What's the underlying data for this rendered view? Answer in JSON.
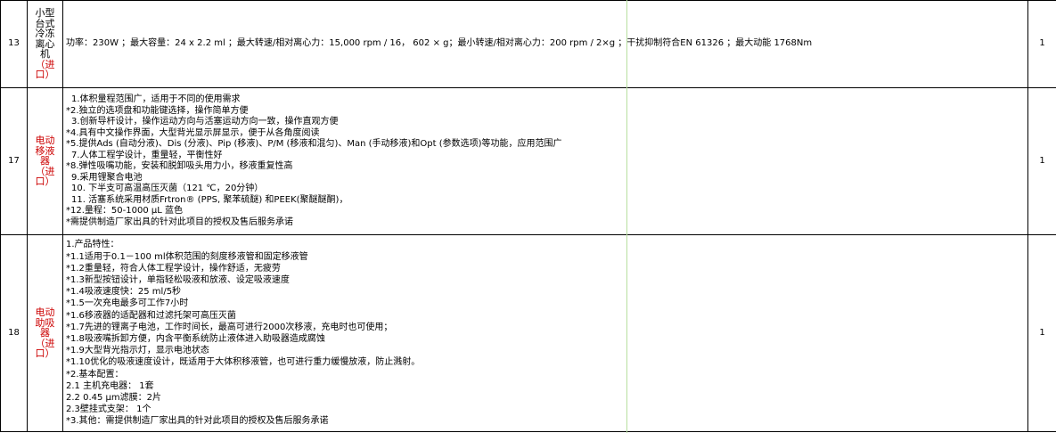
{
  "rows": [
    {
      "index": "13",
      "name_lines": [
        "小型",
        "台式",
        "冷冻",
        "离心",
        "机"
      ],
      "import_lines": [
        "（进",
        "口）"
      ],
      "spec_lines": [
        "功率：230W ；最大容量：24 x 2.2 ml ；最大转速/相对离心力：15,000 rpm / 16， 602 × g；最小转速/相对离心力：200 rpm / 2×g ；干扰抑制符合EN 61326 ；最大动能 1768Nm"
      ],
      "qty": "1"
    },
    {
      "index": "17",
      "name_lines": [
        "电动",
        "移液",
        "器"
      ],
      "import_lines": [
        "（进",
        "口）"
      ],
      "spec_lines": [
        "1.体积量程范围广，适用于不同的使用需求",
        "*2.独立的选项盘和功能键选择，操作简单方便",
        "3.创新导杆设计，操作运动方向与活塞运动方向一致，操作直观方便",
        "*4.具有中文操作界面，大型背光显示屏显示，便于从各角度阅读",
        "*5.提供Ads (自动分液)、Dis (分液)、Pip (移液)、P/M (移液和混匀)、Man (手动移液)和Opt (参数选项)等功能，应用范围广",
        "7.人体工程学设计，重量轻，平衡性好",
        "*8.弹性吸嘴功能，安装和脱卸吸头用力小，移液重复性高",
        "9.采用锂聚合电池",
        "10. 下半支可高温高压灭菌（121 ℃，20分钟）",
        "11. 活塞系统采用材质Frtron® (PPS, 聚苯硫醚) 和PEEK(聚醚醚酮)，",
        "*12.量程：50-1000 μL  蓝色",
        "*需提供制造厂家出具的针对此项目的授权及售后服务承诺"
      ],
      "qty": "1"
    },
    {
      "index": "18",
      "name_lines": [
        "电动",
        "助吸",
        "器"
      ],
      "import_lines": [
        "（进",
        "口）"
      ],
      "spec_lines": [
        "1.产品特性：",
        "*1.1适用于0.1－100 ml体积范围的刻度移液管和固定移液管",
        "*1.2重量轻，符合人体工程学设计，操作舒适，无疲劳",
        "*1.3新型按钮设计，单指轻松吸液和放液、设定吸液速度",
        "*1.4吸液速度快：25 ml/5秒",
        "*1.5一次充电最多可工作7小时",
        "*1.6移液器的适配器和过滤托架可高压灭菌",
        "*1.7先进的锂离子电池，工作时间长，最高可进行2000次移液，充电时也可使用；",
        "*1.8吸液嘴拆卸方便，内含平衡系统防止液体进入助吸器造成腐蚀",
        "*1.9大型背光指示灯，显示电池状态",
        "*1.10优化的吸液速度设计，既适用于大体积移液管，也可进行重力缓慢放液，防止溅射。",
        "*2.基本配置：",
        "2.1 主机充电器：  1套",
        "2.2  0.45 μm滤膜：2片",
        "2.3壁挂式支架：  1个",
        "*3.其他：需提供制造厂家出具的针对此项目的授权及售后服务承诺"
      ],
      "qty": "1"
    }
  ]
}
